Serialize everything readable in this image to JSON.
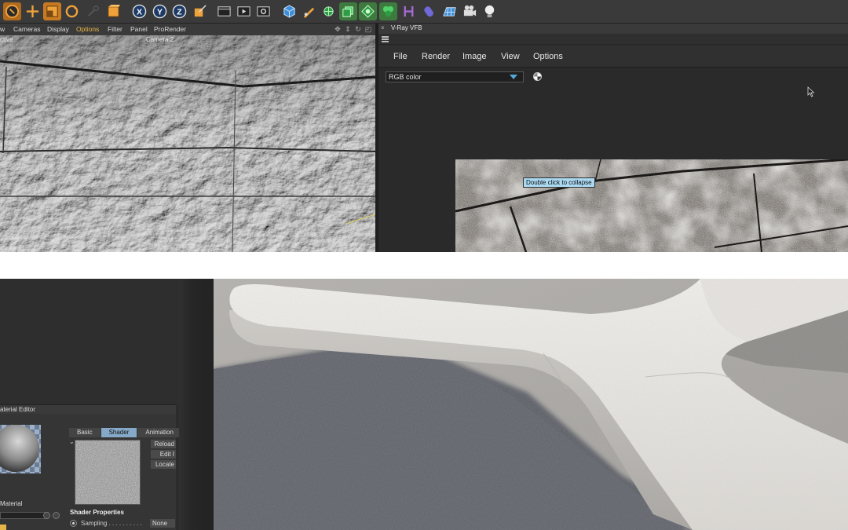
{
  "toolbar": {
    "icons": [
      "live-selection-icon",
      "move-icon",
      "scale-icon",
      "rotate-icon",
      "recent-tool-icon",
      "model-mode-icon",
      "x-axis-icon",
      "y-axis-icon",
      "z-axis-icon",
      "coordinate-system-icon",
      "render-view-icon",
      "render-picture-viewer-icon",
      "render-settings-icon",
      "cube-icon",
      "pen-icon",
      "subdivision-icon",
      "cloner-icon",
      "deformer-icon",
      "environment-icon",
      "spline-icon",
      "generator-icon",
      "floor-grid-icon",
      "camera-icon",
      "light-icon"
    ],
    "axis_labels": {
      "x": "X",
      "y": "Y",
      "z": "Z"
    }
  },
  "viewport": {
    "menu": [
      "w",
      "Cameras",
      "Display",
      "Options",
      "Filter",
      "Panel",
      "ProRender"
    ],
    "active_menu": "Options",
    "label_left": "ctive",
    "label_camera": "Camera.2"
  },
  "vfb": {
    "close": "×",
    "title": "V-Ray VFB",
    "menu": [
      "File",
      "Render",
      "Image",
      "View",
      "Options"
    ],
    "channel": "RGB color",
    "tooltip": "Double click to collapse"
  },
  "material_editor": {
    "title": "aterial Editor",
    "material_name": "Material",
    "tabs": [
      "Basic",
      "Shader",
      "Animation"
    ],
    "selected_tab": "Shader",
    "side_buttons": [
      "Reload",
      "Edit I",
      "Locate"
    ],
    "section": "Shader Properties",
    "sampling_label": "Sampling . . . . . . . . . .",
    "sampling_value": "None"
  },
  "colors": {
    "ui_dark": "#2b2b2b",
    "toolbar": "#3a3a3a",
    "accent_orange": "#e7b545",
    "select_blue": "#55a7d6",
    "tab_selected": "#86a9c9",
    "tooltip_bg": "#a9d8f0"
  }
}
